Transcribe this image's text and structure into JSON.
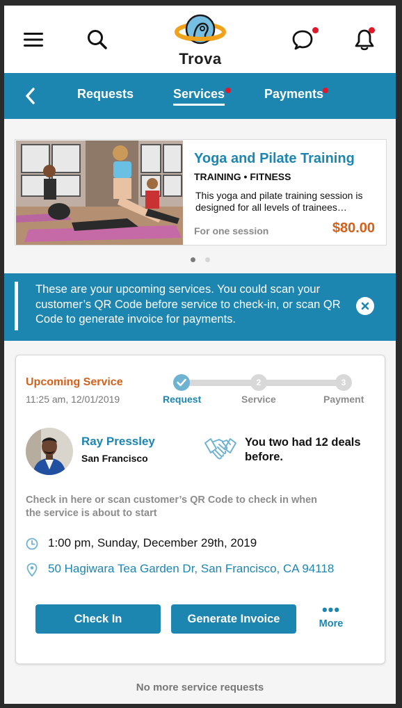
{
  "header": {
    "logo_text": "Trova",
    "menu_icon": "hamburger-menu-icon",
    "search_icon": "search-icon",
    "chat_icon": "chat-bubble-icon",
    "bell_icon": "bell-icon"
  },
  "tabs": {
    "back_icon": "chevron-left-icon",
    "items": [
      {
        "label": "Requests",
        "badge": false
      },
      {
        "label": "Services",
        "badge": true,
        "active": true
      },
      {
        "label": "Payments",
        "badge": true
      }
    ]
  },
  "featured": {
    "title": "Yoga and Pilate Training",
    "category": "TRAINING • FITNESS",
    "description": "This yoga and pilate training session is designed for all levels of  trainees…",
    "per": "For one session",
    "price": "$80.00",
    "carousel_index": 1,
    "carousel_count": 2
  },
  "banner": {
    "text": "These are your upcoming services. You could scan your customer’s QR Code before service to check-in, or scan QR Code to generate invoice for payments.",
    "close_icon": "close-icon"
  },
  "service": {
    "title": "Upcoming Service",
    "time": "11:25 am, 12/01/2019",
    "steps": [
      {
        "label": "Request",
        "number": "",
        "done": true
      },
      {
        "label": "Service",
        "number": "2",
        "done": false
      },
      {
        "label": "Payment",
        "number": "3",
        "done": false
      }
    ],
    "person": {
      "name": "Ray Pressley",
      "city": "San Francisco"
    },
    "deals_text": "You two had 12 deals before.",
    "note": "Check in here or scan customer’s QR Code to check in when the service is about to start",
    "when": "1:00 pm, Sunday, December 29th, 2019",
    "where": "50 Hagiwara Tea Garden Dr, San Francisco, CA 94118",
    "check_in_label": "Check In",
    "invoice_label": "Generate Invoice",
    "more_dots": "•••",
    "more_label": "More"
  },
  "footer_text": "No more service requests",
  "colors": {
    "brand_blue": "#1c85b0",
    "accent_orange": "#d3611b",
    "badge_red": "#e0192a",
    "check_blue": "#6fb3d2"
  }
}
